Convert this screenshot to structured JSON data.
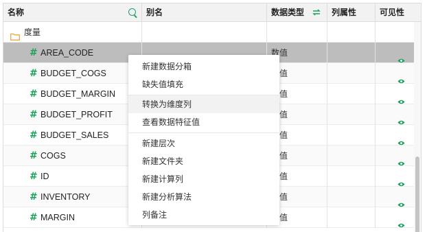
{
  "header": {
    "name": "名称",
    "alias": "别名",
    "data_type": "数据类型",
    "column_property": "列属性",
    "visibility": "可见性"
  },
  "folder": {
    "label": "度量"
  },
  "rows": [
    {
      "name": "AREA_CODE",
      "type": "数值"
    },
    {
      "name": "BUDGET_COGS",
      "type": "数值"
    },
    {
      "name": "BUDGET_MARGIN",
      "type": "数值"
    },
    {
      "name": "BUDGET_PROFIT",
      "type": "数值"
    },
    {
      "name": "BUDGET_SALES",
      "type": "数值"
    },
    {
      "name": "COGS",
      "type": "数值"
    },
    {
      "name": "ID",
      "type": "数值"
    },
    {
      "name": "INVENTORY",
      "type": "数值"
    },
    {
      "name": "MARGIN",
      "type": "数值"
    }
  ],
  "context_menu": {
    "new_bin": "新建数据分箱",
    "fill_missing": "缺失值填充",
    "to_dimension": "转换为维度列",
    "view_features": "查看数据特征值",
    "new_hierarchy": "新建层次",
    "new_folder": "新建文件夹",
    "new_calc_column": "新建计算列",
    "new_analysis": "新建分析算法",
    "column_note": "列备注"
  },
  "colors": {
    "accent": "#1aa35b",
    "selected_row": "#bdbdbd",
    "folder": "#f0a83a"
  },
  "icons": {
    "hash": "#",
    "folder": "folder-icon",
    "eye": "eye-icon",
    "search": "search-icon",
    "swap": "swap-icon"
  }
}
